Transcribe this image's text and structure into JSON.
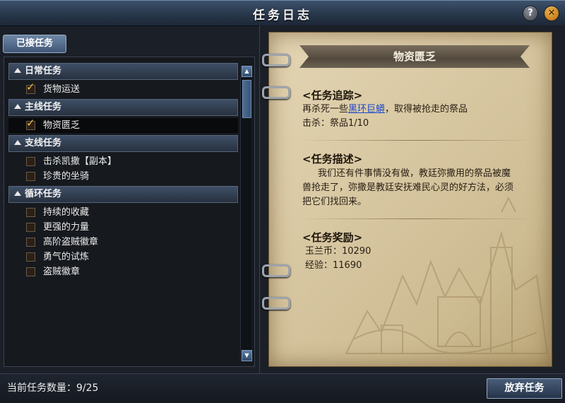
{
  "window": {
    "title": "任务日志",
    "help_glyph": "?",
    "close_glyph": "✕"
  },
  "tabs": [
    {
      "label": "已接任务",
      "active": true
    }
  ],
  "quest_list": {
    "categories": [
      {
        "label": "日常任务",
        "expanded": true,
        "items": [
          {
            "label": "货物运送",
            "checked": true,
            "selected": false
          }
        ]
      },
      {
        "label": "主线任务",
        "expanded": true,
        "items": [
          {
            "label": "物资匮乏",
            "checked": true,
            "selected": true
          }
        ]
      },
      {
        "label": "支线任务",
        "expanded": true,
        "items": [
          {
            "label": "击杀凯撒【副本】",
            "checked": false,
            "selected": false
          },
          {
            "label": "珍贵的坐骑",
            "checked": false,
            "selected": false
          }
        ]
      },
      {
        "label": "循环任务",
        "expanded": true,
        "items": [
          {
            "label": "持续的收藏",
            "checked": false,
            "selected": false
          },
          {
            "label": "更强的力量",
            "checked": false,
            "selected": false
          },
          {
            "label": "高阶盗贼徽章",
            "checked": false,
            "selected": false
          },
          {
            "label": "勇气的试炼",
            "checked": false,
            "selected": false
          },
          {
            "label": "盗贼徽章",
            "checked": false,
            "selected": false
          }
        ]
      }
    ]
  },
  "detail": {
    "quest_title": "物资匮乏",
    "tracking": {
      "header": "<任务追踪>",
      "line1_prefix": "再杀死一些",
      "line1_link": "黑环巨蟒",
      "line1_suffix": "，取得被抢走的祭品",
      "line2": "击杀：祭品1/10"
    },
    "description": {
      "header": "<任务描述>",
      "lines": [
        "我们还有件事情没有做，教廷弥撒用的祭品被魔",
        "兽抢走了，弥撒是教廷安抚难民心灵的好方法，必须",
        "把它们找回来。"
      ]
    },
    "rewards": {
      "header": "<任务奖励>",
      "lines": [
        "玉兰币：10290",
        "经验：11690"
      ]
    }
  },
  "footer": {
    "count_label": "当前任务数量：9/25",
    "abandon_button": "放弃任务"
  },
  "colors": {
    "link": "#1f49c9",
    "check": "#f0c040",
    "parchment": "#d8c8a2"
  }
}
